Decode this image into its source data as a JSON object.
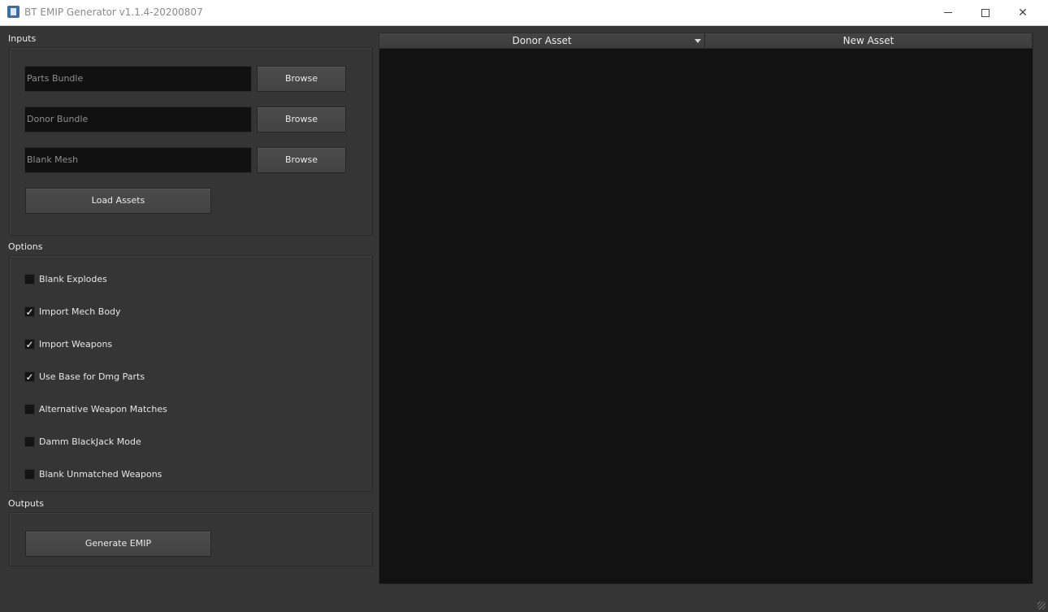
{
  "window": {
    "title": "BT EMIP Generator v1.1.4-20200807",
    "controls": {
      "minimize": "minimize-icon",
      "maximize": "maximize-icon",
      "close": "close-icon"
    }
  },
  "inputs": {
    "section_label": "Inputs",
    "fields": [
      {
        "placeholder": "Parts Bundle",
        "button": "Browse"
      },
      {
        "placeholder": "Donor Bundle",
        "button": "Browse"
      },
      {
        "placeholder": "Blank Mesh",
        "button": "Browse"
      }
    ],
    "load_button": "Load Assets"
  },
  "options": {
    "section_label": "Options",
    "items": [
      {
        "label": "Blank Explodes",
        "checked": false
      },
      {
        "label": "Import Mech Body",
        "checked": true
      },
      {
        "label": "Import Weapons",
        "checked": true
      },
      {
        "label": "Use Base for Dmg Parts",
        "checked": true
      },
      {
        "label": "Alternative Weapon Matches",
        "checked": false
      },
      {
        "label": "Damm BlackJack Mode",
        "checked": false
      },
      {
        "label": "Blank Unmatched Weapons",
        "checked": false
      }
    ]
  },
  "outputs": {
    "section_label": "Outputs",
    "generate_button": "Generate EMIP"
  },
  "table": {
    "columns": [
      "Donor Asset",
      "New Asset"
    ],
    "sort_indicator": "sort-desc-icon"
  },
  "colors": {
    "window_bg": "#353535",
    "field_bg": "#111111",
    "table_bg": "#121212",
    "button_bg": "#474747"
  }
}
